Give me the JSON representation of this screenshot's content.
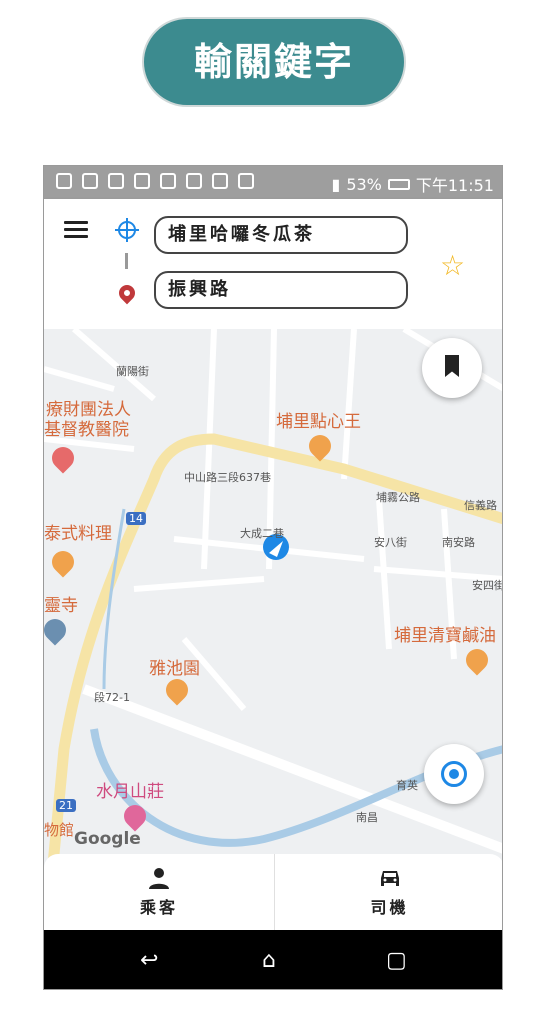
{
  "title": "輸關鍵字",
  "statusbar": {
    "battery": "53%",
    "time": "下午11:51"
  },
  "search": {
    "origin_value": "埔里哈囉冬瓜茶",
    "destination_value": "振興路"
  },
  "map": {
    "pois": [
      "療財團法人",
      "基督教醫院",
      "埔里點心王",
      "泰式料理",
      "靈寺",
      "埔里清寶鹹油",
      "雅池園",
      "水月山莊",
      "物館"
    ],
    "streets": [
      "蘭陽街",
      "中山路三段637巷",
      "大成二巷",
      "埔霧公路",
      "信義路",
      "安八街",
      "南安路",
      "安四街",
      "段72-1",
      "育英",
      "南昌",
      "14",
      "21"
    ],
    "attribution": "Google"
  },
  "tabs": [
    {
      "label": "乘客",
      "icon": "person-icon"
    },
    {
      "label": "司機",
      "icon": "car-icon"
    }
  ],
  "colors": {
    "accent": "#3c8b8f",
    "blue": "#1e88e5",
    "star": "#f2b824"
  }
}
